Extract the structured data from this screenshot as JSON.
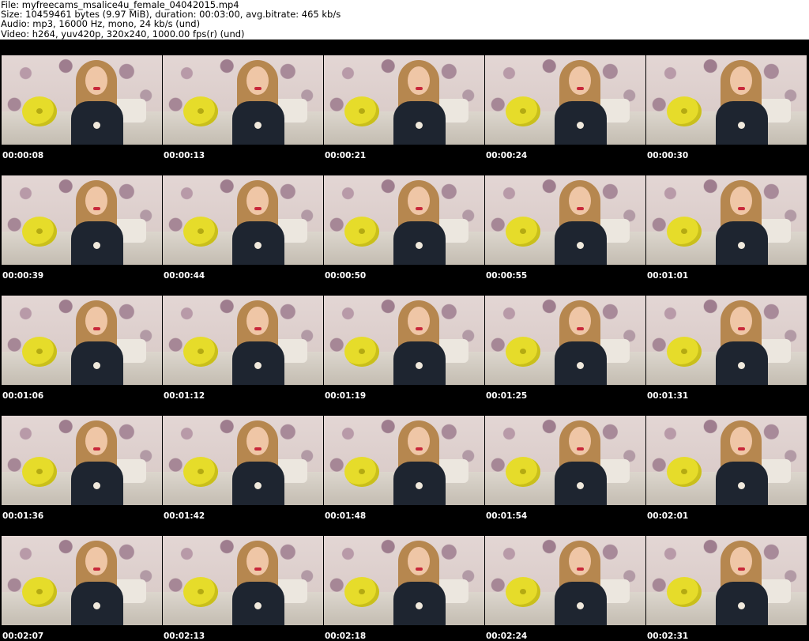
{
  "header": {
    "file": "File: myfreecams_msalice4u_female_04042015.mp4",
    "size": "Size: 10459461 bytes (9.97 MiB), duration: 00:03:00, avg.bitrate: 465 kb/s",
    "audio": "Audio: mp3, 16000 Hz, mono, 24 kb/s (und)",
    "video": "Video: h264, yuv420p, 320x240, 1000.00 fps(r) (und)"
  },
  "thumbnails": [
    {
      "timestamp": "00:00:08"
    },
    {
      "timestamp": "00:00:13"
    },
    {
      "timestamp": "00:00:21"
    },
    {
      "timestamp": "00:00:24"
    },
    {
      "timestamp": "00:00:30"
    },
    {
      "timestamp": "00:00:39"
    },
    {
      "timestamp": "00:00:44"
    },
    {
      "timestamp": "00:00:50"
    },
    {
      "timestamp": "00:00:55"
    },
    {
      "timestamp": "00:01:01"
    },
    {
      "timestamp": "00:01:06"
    },
    {
      "timestamp": "00:01:12"
    },
    {
      "timestamp": "00:01:19"
    },
    {
      "timestamp": "00:01:25"
    },
    {
      "timestamp": "00:01:31"
    },
    {
      "timestamp": "00:01:36"
    },
    {
      "timestamp": "00:01:42"
    },
    {
      "timestamp": "00:01:48"
    },
    {
      "timestamp": "00:01:54"
    },
    {
      "timestamp": "00:02:01"
    },
    {
      "timestamp": "00:02:07"
    },
    {
      "timestamp": "00:02:13"
    },
    {
      "timestamp": "00:02:18"
    },
    {
      "timestamp": "00:02:24"
    },
    {
      "timestamp": "00:02:31"
    }
  ],
  "colors": {
    "background": "#000000",
    "header_background": "#ffffff",
    "timestamp_text": "#ffffff"
  }
}
